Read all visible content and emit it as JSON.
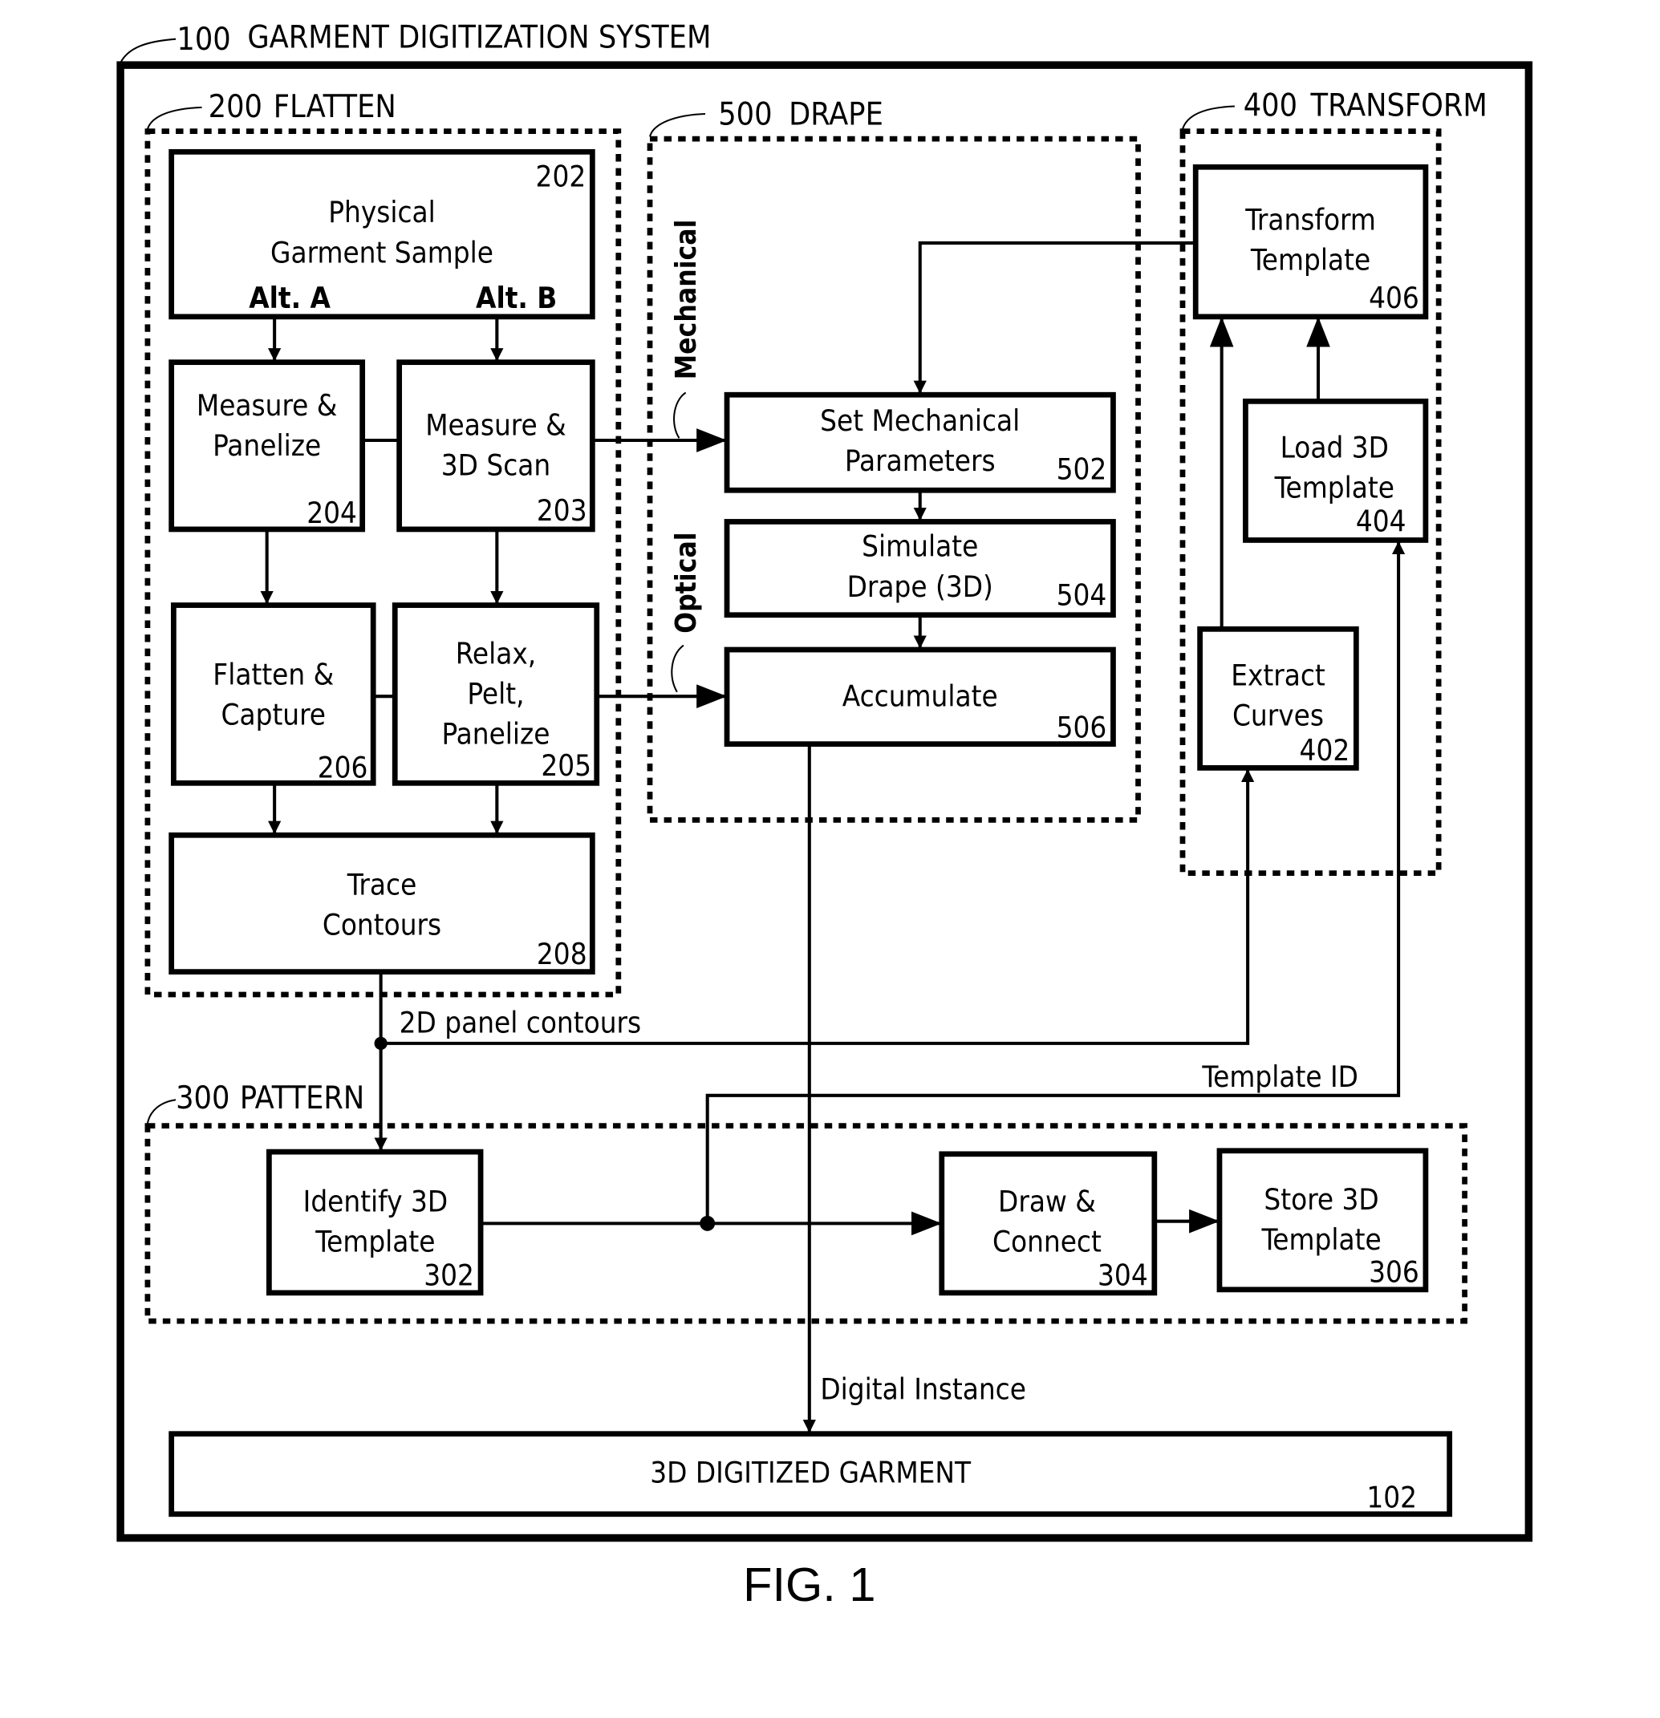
{
  "figure": {
    "caption": "FIG. 1",
    "system": {
      "number": "100",
      "title": "GARMENT DIGITIZATION SYSTEM"
    }
  },
  "groups": {
    "flatten": {
      "number": "200",
      "title": "FLATTEN"
    },
    "drape": {
      "number": "500",
      "title": "DRAPE"
    },
    "transform": {
      "number": "400",
      "title": "TRANSFORM"
    },
    "pattern": {
      "number": "300",
      "title": "PATTERN"
    }
  },
  "boxes": {
    "b202": {
      "lines": [
        "Physical",
        "Garment Sample"
      ],
      "number": "202",
      "alt_a": "Alt. A",
      "alt_b": "Alt. B"
    },
    "b204": {
      "lines": [
        "Measure &",
        "Panelize"
      ],
      "number": "204"
    },
    "b203": {
      "lines": [
        "Measure &",
        "3D Scan"
      ],
      "number": "203"
    },
    "b206": {
      "lines": [
        "Flatten &",
        "Capture"
      ],
      "number": "206"
    },
    "b205": {
      "lines": [
        "Relax,",
        "Pelt,",
        "Panelize"
      ],
      "number": "205"
    },
    "b208": {
      "lines": [
        "Trace",
        "Contours"
      ],
      "number": "208"
    },
    "b502": {
      "lines": [
        "Set Mechanical",
        "Parameters"
      ],
      "number": "502"
    },
    "b504": {
      "lines": [
        "Simulate",
        "Drape (3D)"
      ],
      "number": "504"
    },
    "b506": {
      "lines": [
        "Accumulate"
      ],
      "number": "506"
    },
    "b406": {
      "lines": [
        "Transform",
        "Template"
      ],
      "number": "406"
    },
    "b404": {
      "lines": [
        "Load 3D",
        "Template"
      ],
      "number": "404"
    },
    "b402": {
      "lines": [
        "Extract",
        "Curves"
      ],
      "number": "402"
    },
    "b302": {
      "lines": [
        "Identify 3D",
        "Template"
      ],
      "number": "302"
    },
    "b304": {
      "lines": [
        "Draw &",
        "Connect"
      ],
      "number": "304"
    },
    "b306": {
      "lines": [
        "Store 3D",
        "Template"
      ],
      "number": "306"
    },
    "b102": {
      "lines": [
        "3D DIGITIZED GARMENT"
      ],
      "number": "102"
    }
  },
  "edge_labels": {
    "mechanical": "Mechanical",
    "optical": "Optical",
    "panel_contours": "2D panel contours",
    "template_id": "Template ID",
    "digital_instance": "Digital Instance"
  }
}
